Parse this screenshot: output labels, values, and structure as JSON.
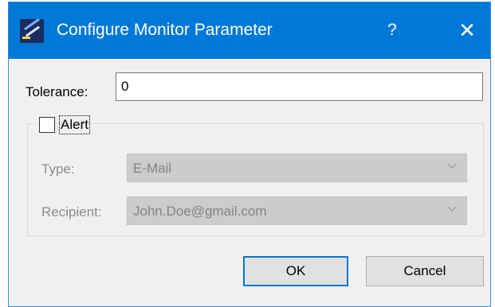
{
  "window": {
    "title": "Configure Monitor Parameter",
    "help_glyph": "?",
    "close_glyph": "✕",
    "app_icon": "app-logo-icon",
    "accent_color": "#0078d7"
  },
  "tolerance": {
    "label": "Tolerance:",
    "value": "0"
  },
  "alert": {
    "label": "Alert",
    "checked": false,
    "type": {
      "label": "Type:",
      "value": "E-Mail",
      "enabled": false
    },
    "recipient": {
      "label": "Recipient:",
      "value": "John.Doe@gmail.com",
      "enabled": false
    }
  },
  "buttons": {
    "ok_label": "OK",
    "cancel_label": "Cancel"
  }
}
